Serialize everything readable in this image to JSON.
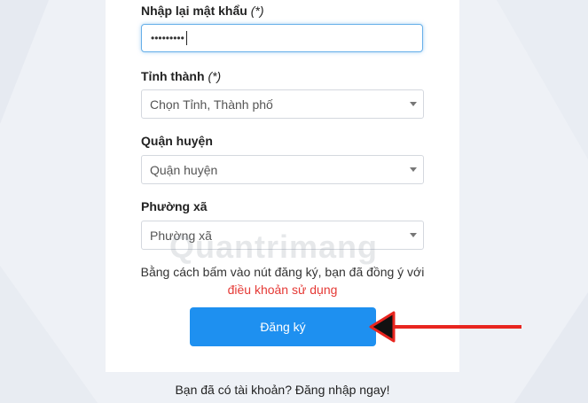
{
  "form": {
    "confirm_password": {
      "label": "Nhập lại mật khẩu",
      "required_mark": "(*)",
      "masked_value": "•••••••••"
    },
    "province": {
      "label": "Tỉnh thành",
      "required_mark": "(*)",
      "selected": "Chọn Tỉnh, Thành phố"
    },
    "district": {
      "label": "Quận huyện",
      "selected": "Quận huyện"
    },
    "ward": {
      "label": "Phường xã",
      "selected": "Phường xã"
    },
    "terms_text": "Bằng cách bấm vào nút đăng ký, bạn đã đồng ý với",
    "terms_link": "điều khoản sử dụng",
    "register_label": "Đăng ký"
  },
  "footer": {
    "have_account_text": "Bạn đã có tài khoản?",
    "login_link": "Đăng nhập ngay!"
  },
  "watermark": "Quantrimang",
  "annotation": {
    "arrow_icon": "red-pointer-arrow-icon"
  },
  "colors": {
    "accent": "#1e90f0",
    "link_red": "#e53935",
    "annotation_red": "#e8251f"
  }
}
